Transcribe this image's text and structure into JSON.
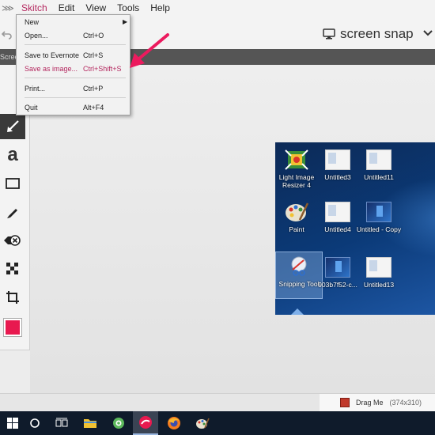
{
  "menubar": {
    "items": [
      "Skitch",
      "Edit",
      "View",
      "Tools",
      "Help"
    ]
  },
  "toolbar": {
    "snap_label": "screen snap"
  },
  "darkstrip": {
    "text": "Scree"
  },
  "file_menu": {
    "items": [
      {
        "label": "New",
        "shortcut": ""
      },
      {
        "label": "Open...",
        "shortcut": "Ctrl+O"
      },
      {
        "label": "Save to Evernote",
        "shortcut": "Ctrl+S"
      },
      {
        "label": "Save as image...",
        "shortcut": "Ctrl+Shift+S"
      },
      {
        "label": "Print...",
        "shortcut": "Ctrl+P"
      },
      {
        "label": "Quit",
        "shortcut": "Alt+F4"
      }
    ]
  },
  "tools": {
    "text_glyph": "a",
    "color": "#e8194f"
  },
  "desktop": {
    "icons": [
      "Light Image Resizer 4",
      "Untitled3",
      "Untitled11",
      "Paint",
      "Untitled4",
      "Untitled - Copy",
      "Snipping Tool",
      "903b7f52-c...",
      "Untitled13"
    ]
  },
  "status": {
    "drag_label": "Drag Me",
    "dimensions": "(374x310)"
  },
  "taskbar": {
    "items": [
      "start-icon",
      "cortana-icon",
      "task-view-icon",
      "file-explorer-icon",
      "greenshot-icon",
      "skitch-icon",
      "firefox-icon",
      "paint-icon"
    ]
  },
  "colors": {
    "accent": "#b4285f",
    "annotation": "#ec1a5e"
  }
}
